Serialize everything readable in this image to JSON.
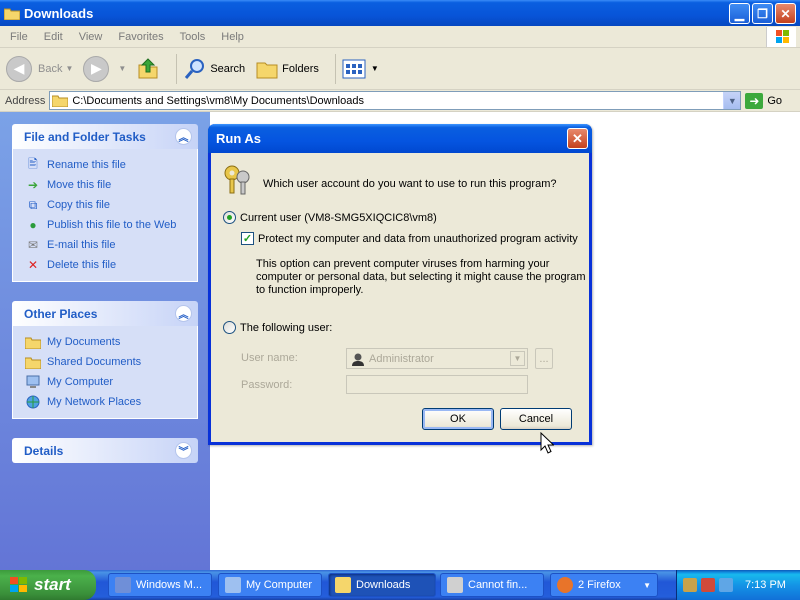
{
  "window": {
    "title": "Downloads",
    "menu": [
      "File",
      "Edit",
      "View",
      "Favorites",
      "Tools",
      "Help"
    ],
    "toolbar": {
      "back": "Back",
      "search": "Search",
      "folders": "Folders"
    },
    "address": {
      "label": "Address",
      "path": "C:\\Documents and Settings\\vm8\\My Documents\\Downloads",
      "go": "Go"
    }
  },
  "taskpane": {
    "file_tasks": {
      "title": "File and Folder Tasks",
      "items": [
        {
          "label": "Rename this file",
          "icon": "rename-icon"
        },
        {
          "label": "Move this file",
          "icon": "move-icon"
        },
        {
          "label": "Copy this file",
          "icon": "copy-icon"
        },
        {
          "label": "Publish this file to the Web",
          "icon": "globe-icon"
        },
        {
          "label": "E-mail this file",
          "icon": "email-icon"
        },
        {
          "label": "Delete this file",
          "icon": "delete-icon"
        }
      ]
    },
    "other_places": {
      "title": "Other Places",
      "items": [
        {
          "label": "My Documents",
          "icon": "folder-icon"
        },
        {
          "label": "Shared Documents",
          "icon": "folder-icon"
        },
        {
          "label": "My Computer",
          "icon": "computer-icon"
        },
        {
          "label": "My Network Places",
          "icon": "network-icon"
        }
      ]
    },
    "details": {
      "title": "Details"
    }
  },
  "dialog": {
    "title": "Run As",
    "question": "Which user account do you want to use to run this program?",
    "current_user": "Current user (VM8-SMG5XIQCIC8\\vm8)",
    "protect": "Protect my computer and data from unauthorized program activity",
    "note": "This option can prevent computer viruses from harming your computer or personal data, but selecting it might cause the program to function improperly.",
    "following_user": "The following user:",
    "username_label": "User name:",
    "username_value": "Administrator",
    "password_label": "Password:",
    "browse": "...",
    "ok": "OK",
    "cancel": "Cancel"
  },
  "taskbar": {
    "start": "start",
    "tasks": [
      "Windows M...",
      "My Computer",
      "Downloads",
      "Cannot fin...",
      "2 Firefox"
    ],
    "clock": "7:13 PM"
  },
  "colors": {
    "xp_blue": "#0054e3",
    "link_blue": "#215dc6",
    "start_green": "#3c9a3c"
  }
}
